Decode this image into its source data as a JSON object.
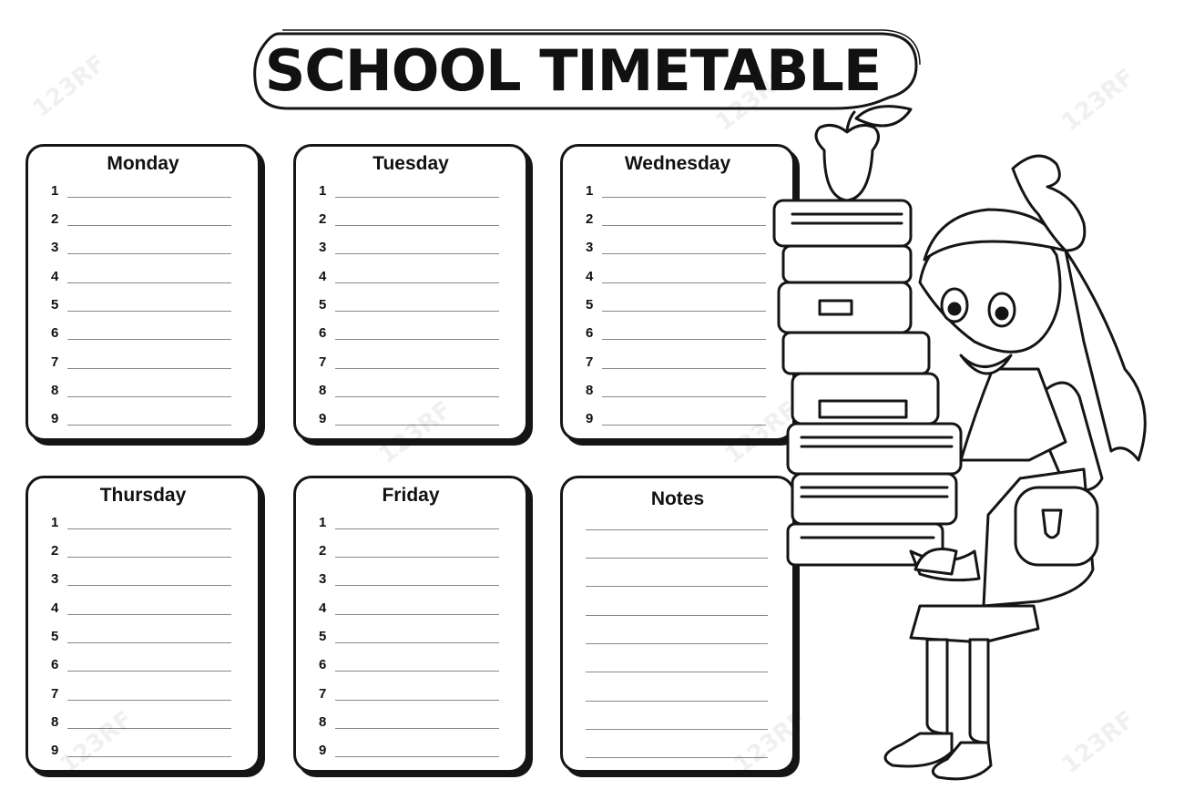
{
  "title": "SCHOOL TIMETABLE",
  "days": [
    {
      "name": "Monday",
      "periods": [
        "1",
        "2",
        "3",
        "4",
        "5",
        "6",
        "7",
        "8",
        "9"
      ]
    },
    {
      "name": "Tuesday",
      "periods": [
        "1",
        "2",
        "3",
        "4",
        "5",
        "6",
        "7",
        "8",
        "9"
      ]
    },
    {
      "name": "Wednesday",
      "periods": [
        "1",
        "2",
        "3",
        "4",
        "5",
        "6",
        "7",
        "8",
        "9"
      ]
    },
    {
      "name": "Thursday",
      "periods": [
        "1",
        "2",
        "3",
        "4",
        "5",
        "6",
        "7",
        "8",
        "9"
      ]
    },
    {
      "name": "Friday",
      "periods": [
        "1",
        "2",
        "3",
        "4",
        "5",
        "6",
        "7",
        "8",
        "9"
      ]
    }
  ],
  "notes": {
    "title": "Notes"
  },
  "watermark": "123RF",
  "illustration": {
    "icons": [
      "apple-icon",
      "book-stack-icon",
      "girl-with-backpack-icon"
    ]
  },
  "colors": {
    "ink": "#151515",
    "rule": "#888888",
    "background": "#ffffff"
  }
}
